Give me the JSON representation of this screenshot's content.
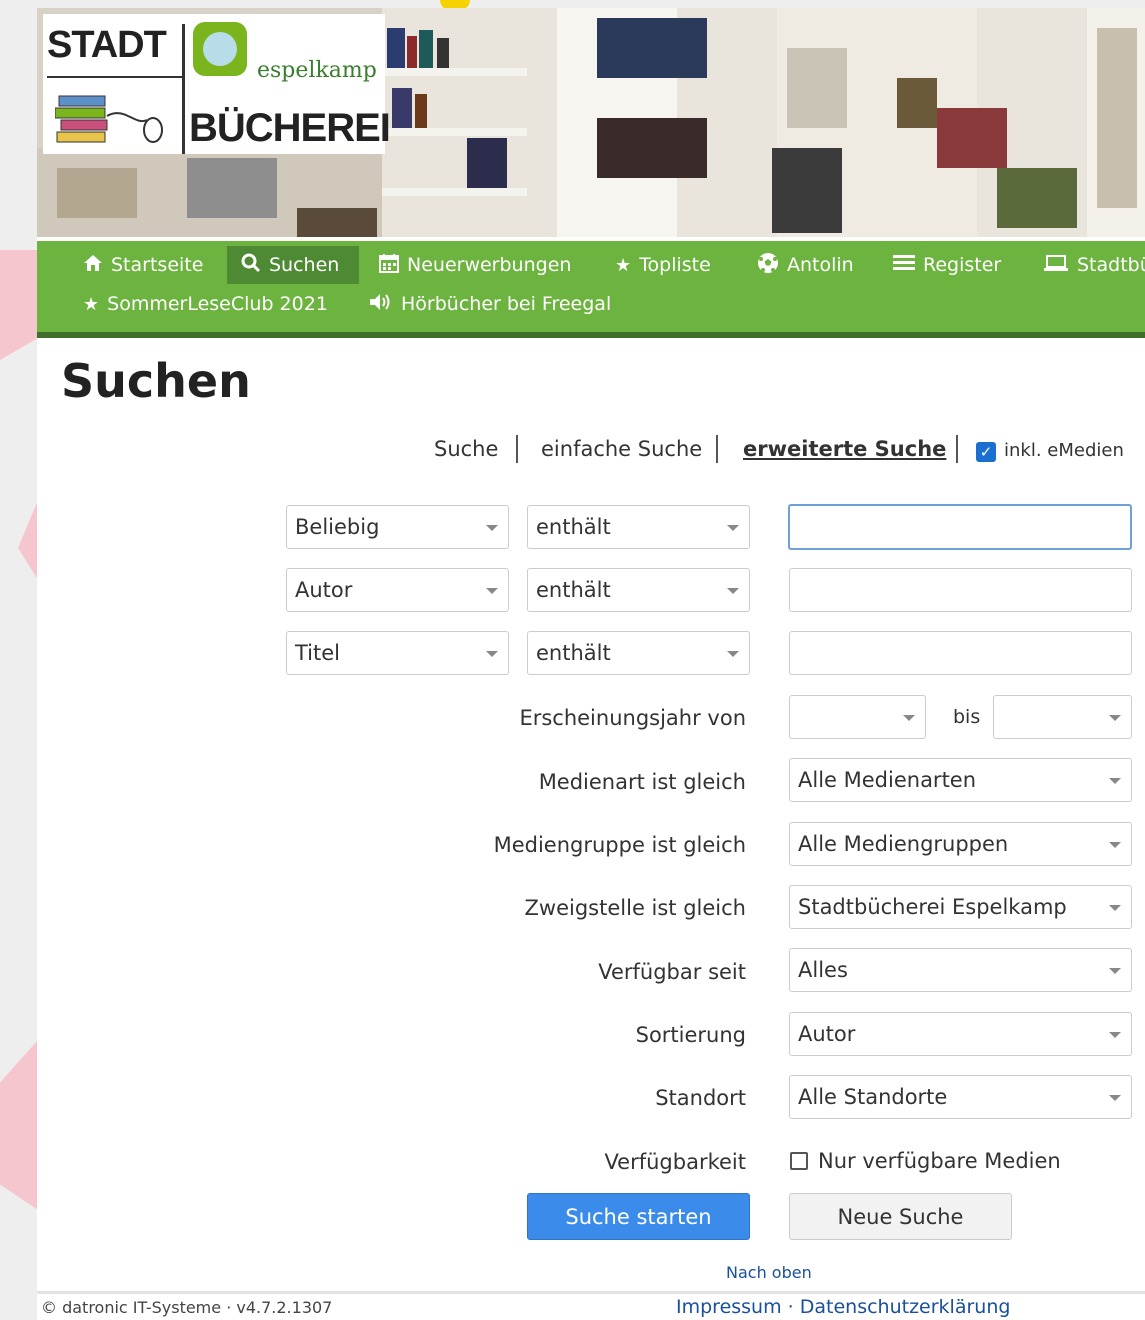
{
  "logo": {
    "stadt": "STADT",
    "espelkamp": "espelkamp",
    "buecherei": "BÜCHEREI"
  },
  "nav": {
    "items": [
      {
        "label": "Startseite",
        "icon": "home-icon"
      },
      {
        "label": "Suchen",
        "icon": "search-icon",
        "active": true
      },
      {
        "label": "Neuerwerbungen",
        "icon": "calendar-icon"
      },
      {
        "label": "Topliste",
        "icon": "star-icon"
      },
      {
        "label": "Antolin",
        "icon": "soccer-ball-icon"
      },
      {
        "label": "Register",
        "icon": "list-icon"
      },
      {
        "label": "Stadtbü",
        "icon": "laptop-icon"
      },
      {
        "label": "SommerLeseClub 2021",
        "icon": "star-icon"
      },
      {
        "label": "Hörbücher bei Freegal",
        "icon": "speaker-icon"
      }
    ]
  },
  "page": {
    "title": "Suchen"
  },
  "tabs": {
    "suche": "Suche",
    "einfache": "einfache Suche",
    "erweiterte": "erweiterte Suche",
    "emedien": "inkl. eMedien",
    "emedien_checked": true
  },
  "criteria": [
    {
      "field": "Beliebig",
      "operator": "enthält",
      "value": ""
    },
    {
      "field": "Autor",
      "operator": "enthält",
      "value": ""
    },
    {
      "field": "Titel",
      "operator": "enthält",
      "value": ""
    }
  ],
  "filters": {
    "jahr_label": "Erscheinungsjahr von",
    "jahr_von": "",
    "bis_label": "bis",
    "jahr_bis": "",
    "medienart_label": "Medienart ist gleich",
    "medienart_value": "Alle Medienarten",
    "mediengruppe_label": "Mediengruppe ist gleich",
    "mediengruppe_value": "Alle Mediengruppen",
    "zweigstelle_label": "Zweigstelle ist gleich",
    "zweigstelle_value": "Stadtbücherei Espelkamp",
    "verfuegbar_seit_label": "Verfügbar seit",
    "verfuegbar_seit_value": "Alles",
    "sortierung_label": "Sortierung",
    "sortierung_value": "Autor",
    "standort_label": "Standort",
    "standort_value": "Alle Standorte",
    "verfuegbarkeit_label": "Verfügbarkeit",
    "nur_verfuegbar_label": "Nur verfügbare Medien",
    "nur_verfuegbar_checked": false
  },
  "buttons": {
    "start": "Suche starten",
    "neu": "Neue Suche"
  },
  "footer": {
    "nach_oben": "Nach oben",
    "copyright": "© datronic IT-Systeme · v4.7.2.1307",
    "impressum": "Impressum",
    "separator": " · ",
    "datenschutz": "Datenschutzerklärung"
  },
  "colors": {
    "nav_green": "#6cb33f",
    "nav_active": "#4e8a34",
    "primary_button": "#3b8bea",
    "link": "#1a4f9c"
  }
}
